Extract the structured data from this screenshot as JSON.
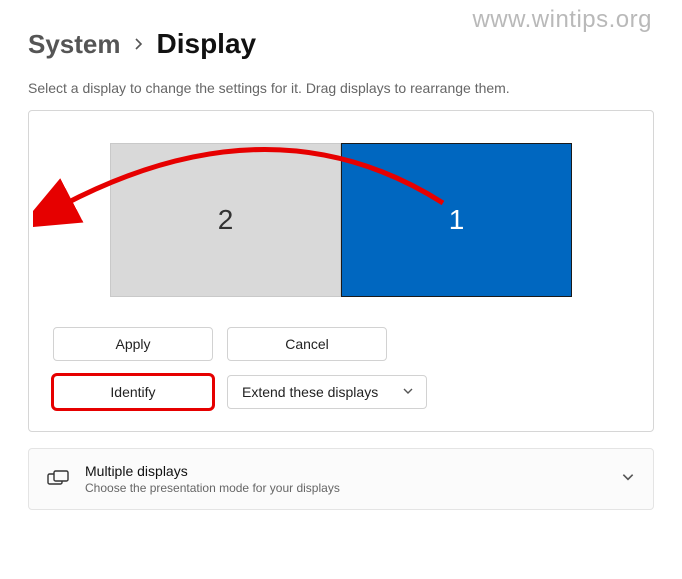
{
  "watermark": "www.wintips.org",
  "breadcrumb": {
    "parent": "System",
    "current": "Display"
  },
  "instruction": "Select a display to change the settings for it. Drag displays to rearrange them.",
  "monitors": {
    "left_label": "2",
    "right_label": "1"
  },
  "buttons": {
    "apply": "Apply",
    "cancel": "Cancel",
    "identify": "Identify"
  },
  "display_mode": {
    "selected": "Extend these displays"
  },
  "expander": {
    "title": "Multiple displays",
    "subtitle": "Choose the presentation mode for your displays"
  }
}
